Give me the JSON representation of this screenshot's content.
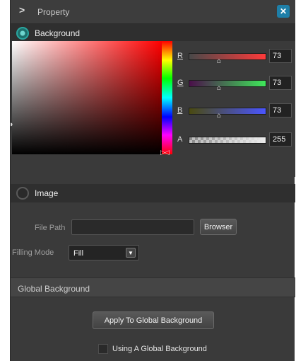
{
  "header": {
    "title": "Property",
    "chevron": ">",
    "pin_icon": "pin-icon"
  },
  "background_section": {
    "label": "Background",
    "selected": true
  },
  "channels": [
    {
      "letter": "R",
      "value": "73"
    },
    {
      "letter": "G",
      "value": "73"
    },
    {
      "letter": "B",
      "value": "73"
    },
    {
      "letter": "A",
      "value": "255"
    }
  ],
  "image_section": {
    "label": "Image",
    "selected": false,
    "file_path_label": "File Path",
    "file_path_value": "",
    "browse_button": "Browser",
    "filling_mode_label": "Filling Mode",
    "filling_mode_value": "Fill"
  },
  "global_background": {
    "header": "Global Background",
    "apply_button": "Apply To Global Background",
    "checkbox_label": "Using A Global Background",
    "checkbox_checked": false
  },
  "colors": {
    "accent_teal": "#2aa6a0",
    "pin_blue": "#1e7fa8",
    "panel_bg": "#3a3a3a"
  }
}
